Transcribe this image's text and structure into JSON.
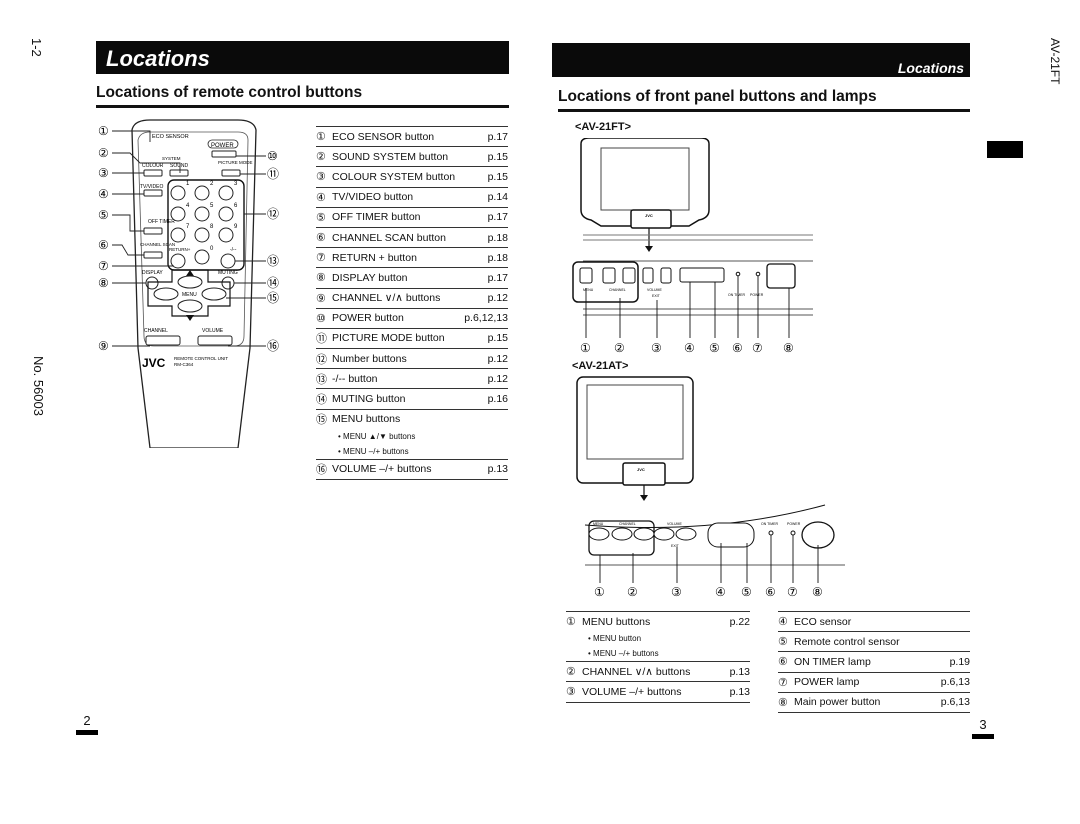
{
  "left_page": {
    "section_code": "1-2",
    "doc_number": "No. 56003",
    "banner_title": "Locations",
    "heading": "Locations of remote control buttons",
    "page_number": "2",
    "remote_labels": {
      "eco_sensor": "ECO SENSOR",
      "power": "POWER",
      "system": "SYSTEM",
      "colour": "COLOUR",
      "sound": "SOUND",
      "picture_mode": "PICTURE MODE",
      "tv_video": "TV/VIDEO",
      "off_timer": "OFF TIMER",
      "channel_scan": "CHANNEL SCAN",
      "return": "RETURN+",
      "dash": "-/--",
      "display": "DISPLAY",
      "muting": "MUTING",
      "menu": "MENU",
      "channel": "CHANNEL",
      "volume": "VOLUME",
      "brand": "JVC",
      "unit_line1": "REMOTE CONTROL UNIT",
      "unit_line2": "RM-C364",
      "digits": [
        "1",
        "2",
        "3",
        "4",
        "5",
        "6",
        "7",
        "8",
        "9",
        "0"
      ]
    },
    "callouts": [
      "①",
      "②",
      "③",
      "④",
      "⑤",
      "⑥",
      "⑦",
      "⑧",
      "⑨",
      "⑩",
      "⑪",
      "⑫",
      "⑬",
      "⑭",
      "⑮",
      "⑯"
    ],
    "items": [
      {
        "num": "①",
        "label": "ECO SENSOR button",
        "page": "p.17"
      },
      {
        "num": "②",
        "label": "SOUND SYSTEM button",
        "page": "p.15"
      },
      {
        "num": "③",
        "label": "COLOUR SYSTEM button",
        "page": "p.15"
      },
      {
        "num": "④",
        "label": "TV/VIDEO button",
        "page": "p.14"
      },
      {
        "num": "⑤",
        "label": "OFF TIMER button",
        "page": "p.17"
      },
      {
        "num": "⑥",
        "label": "CHANNEL SCAN button",
        "page": "p.18"
      },
      {
        "num": "⑦",
        "label": "RETURN + button",
        "page": "p.18"
      },
      {
        "num": "⑧",
        "label": "DISPLAY button",
        "page": "p.17"
      },
      {
        "num": "⑨",
        "label": "CHANNEL ∨/∧ buttons",
        "page": "p.12"
      },
      {
        "num": "⑩",
        "label": "POWER button",
        "page": "p.6,12,13"
      },
      {
        "num": "⑪",
        "label": "PICTURE MODE button",
        "page": "p.15"
      },
      {
        "num": "⑫",
        "label": "Number buttons",
        "page": "p.12"
      },
      {
        "num": "⑬",
        "label": "-/-- button",
        "page": "p.12"
      },
      {
        "num": "⑭",
        "label": "MUTING button",
        "page": "p.16"
      },
      {
        "num": "⑮",
        "label": "MENU buttons",
        "page": "",
        "subs": [
          "• MENU ▲/▼ buttons",
          "• MENU –/+ buttons"
        ]
      },
      {
        "num": "⑯",
        "label": "VOLUME –/+ buttons",
        "page": "p.13"
      }
    ]
  },
  "right_page": {
    "banner_title": "Locations",
    "heading": "Locations of front panel buttons and lamps",
    "model_code": "AV-21FT",
    "page_number": "3",
    "model_a": {
      "name": "<AV-21FT>",
      "panel_labels": {
        "menu": "MENU",
        "channel": "CHANNEL",
        "volume": "VOLUME",
        "exit": "EXIT",
        "on_timer": "ON TIMER",
        "power": "POWER",
        "brand": "JVC"
      },
      "callouts": [
        "①",
        "②",
        "③",
        "④",
        "⑤",
        "⑥",
        "⑦",
        "⑧"
      ]
    },
    "model_b": {
      "name": "<AV-21AT>",
      "panel_labels": {
        "menu": "MENU",
        "channel": "CHANNEL",
        "volume": "VOLUME",
        "exit": "EXIT",
        "on_timer": "ON TIMER",
        "power": "POWER",
        "brand": "JVC"
      },
      "callouts": [
        "①",
        "②",
        "③",
        "④",
        "⑤",
        "⑥",
        "⑦",
        "⑧"
      ]
    },
    "items_left": [
      {
        "num": "①",
        "label": "MENU buttons",
        "page": "p.22",
        "subs": [
          "• MENU button",
          "• MENU –/+ buttons"
        ]
      },
      {
        "num": "②",
        "label": "CHANNEL ∨/∧ buttons",
        "page": "p.13"
      },
      {
        "num": "③",
        "label": "VOLUME –/+ buttons",
        "page": "p.13"
      }
    ],
    "items_right": [
      {
        "num": "④",
        "label": "ECO sensor",
        "page": ""
      },
      {
        "num": "⑤",
        "label": "Remote control sensor",
        "page": ""
      },
      {
        "num": "⑥",
        "label": "ON TIMER lamp",
        "page": "p.19"
      },
      {
        "num": "⑦",
        "label": "POWER lamp",
        "page": "p.6,13"
      },
      {
        "num": "⑧",
        "label": "Main power button",
        "page": "p.6,13"
      }
    ]
  }
}
